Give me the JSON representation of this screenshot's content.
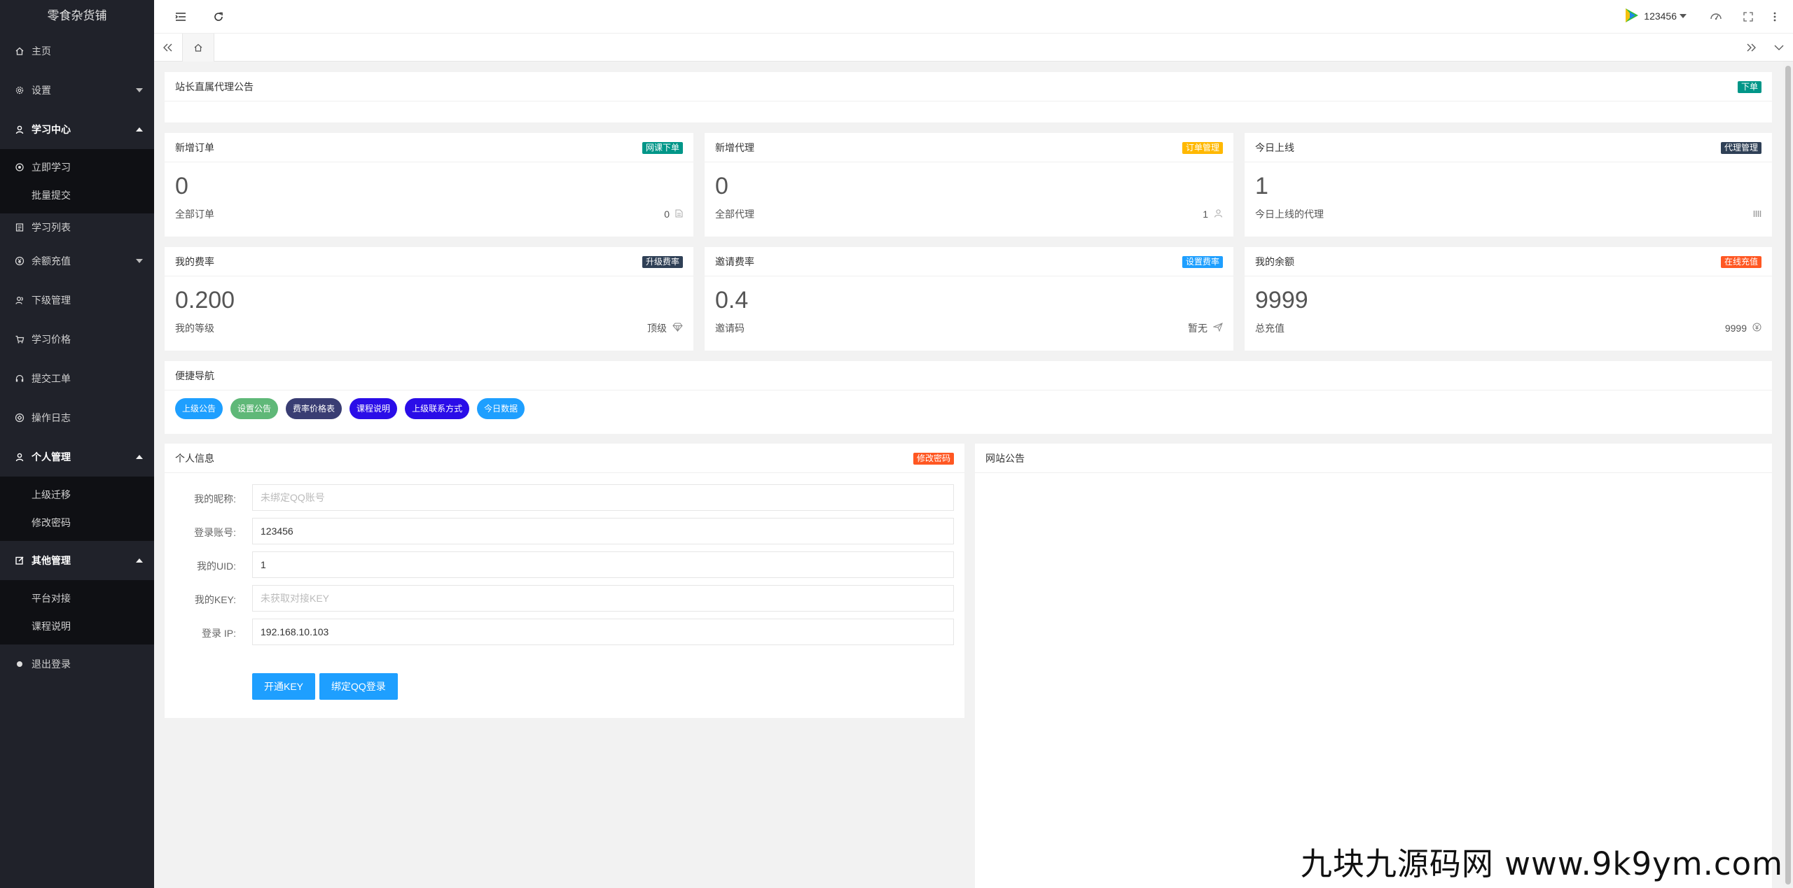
{
  "app": {
    "title": "零食杂货铺"
  },
  "sidebar": {
    "home": "主页",
    "settings": "设置",
    "study_center": "学习中心",
    "study_children": [
      "立即学习",
      "批量提交"
    ],
    "study_list": "学习列表",
    "recharge": "余额充值",
    "sub_manage": "下级管理",
    "study_price": "学习价格",
    "ticket": "提交工单",
    "op_log": "操作日志",
    "personal": "个人管理",
    "personal_children": [
      "上级迁移",
      "修改密码"
    ],
    "other": "其他管理",
    "other_children": [
      "平台对接",
      "课程说明"
    ],
    "logout": "退出登录"
  },
  "header": {
    "username": "123456"
  },
  "notice": {
    "title": "站长直属代理公告",
    "badge": "下单",
    "badge_color": "#009688"
  },
  "stats": [
    {
      "title": "新增订单",
      "badge": "网课下单",
      "badge_color": "#009688",
      "value": "0",
      "sub_label": "全部订单",
      "sub_value": "0"
    },
    {
      "title": "新增代理",
      "badge": "订单管理",
      "badge_color": "#ffb800",
      "value": "0",
      "sub_label": "全部代理",
      "sub_value": "1"
    },
    {
      "title": "今日上线",
      "badge": "代理管理",
      "badge_color": "#2f4056",
      "value": "1",
      "sub_label": "今日上线的代理",
      "sub_value": ""
    },
    {
      "title": "我的费率",
      "badge": "升级费率",
      "badge_color": "#2f4056",
      "value": "0.200",
      "sub_label": "我的等级",
      "sub_value": "顶级"
    },
    {
      "title": "邀请费率",
      "badge": "设置费率",
      "badge_color": "#1e9fff",
      "value": "0.4",
      "sub_label": "邀请码",
      "sub_value": "暂无"
    },
    {
      "title": "我的余额",
      "badge": "在线充值",
      "badge_color": "#ff5722",
      "value": "9999",
      "sub_label": "总充值",
      "sub_value": "9999"
    }
  ],
  "quick_nav": {
    "title": "便捷导航",
    "items": [
      {
        "label": "上级公告",
        "color": "#1e9fff"
      },
      {
        "label": "设置公告",
        "color": "#5fb878"
      },
      {
        "label": "费率价格表",
        "color": "#393d73"
      },
      {
        "label": "课程说明",
        "color": "#2a0de8"
      },
      {
        "label": "上级联系方式",
        "color": "#2a0de8"
      },
      {
        "label": "今日数据",
        "color": "#1e9fff"
      }
    ]
  },
  "profile": {
    "title": "个人信息",
    "badge": "修改密码",
    "badge_color": "#ff5722",
    "fields": [
      {
        "label": "我的昵称:",
        "value": "",
        "placeholder": "未绑定QQ账号"
      },
      {
        "label": "登录账号:",
        "value": "123456",
        "placeholder": ""
      },
      {
        "label": "我的UID:",
        "value": "1",
        "placeholder": ""
      },
      {
        "label": "我的KEY:",
        "value": "",
        "placeholder": "未获取对接KEY"
      },
      {
        "label": "登录 IP:",
        "value": "192.168.10.103",
        "placeholder": ""
      }
    ],
    "btn_key": "开通KEY",
    "btn_qq": "绑定QQ登录"
  },
  "site_notice": {
    "title": "网站公告"
  },
  "watermark": "九块九源码网 www.9k9ym.com"
}
